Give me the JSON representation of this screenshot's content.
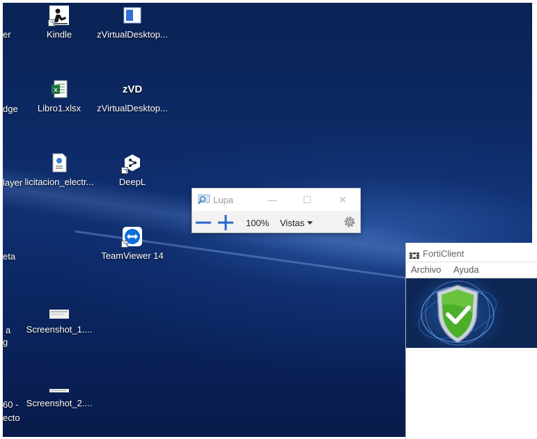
{
  "desktop": {
    "icons": [
      {
        "name": "kindle-icon",
        "label": "Kindle"
      },
      {
        "name": "zvirtualdesktop-1",
        "label": "zVirtualDesktop..."
      },
      {
        "name": "libro1-xlsx",
        "label": "Libro1.xlsx"
      },
      {
        "name": "zvirtualdesktop-2",
        "label": "zVirtualDesktop..."
      },
      {
        "name": "licitacion",
        "label": "licitacion_electr..."
      },
      {
        "name": "deepl",
        "label": "DeepL"
      },
      {
        "name": "teamviewer",
        "label": "TeamViewer 14"
      },
      {
        "name": "screenshot-1",
        "label": "Screenshot_1...."
      },
      {
        "name": "screenshot-2",
        "label": "Screenshot_2...."
      }
    ],
    "cut_labels": [
      "er",
      "dge",
      "layer",
      "eta",
      "a",
      "g",
      "60 -",
      "ecto"
    ]
  },
  "lupa": {
    "title": "Lupa",
    "zoom": "100%",
    "views": "Vistas"
  },
  "forticlient": {
    "title": "FortiClient",
    "menu": [
      "Archivo",
      "Ayuda"
    ]
  },
  "colors": {
    "desktop_bg": "#0d2a66",
    "zoom_blue": "#2a64c6",
    "shield_green": "#4caf2a"
  }
}
